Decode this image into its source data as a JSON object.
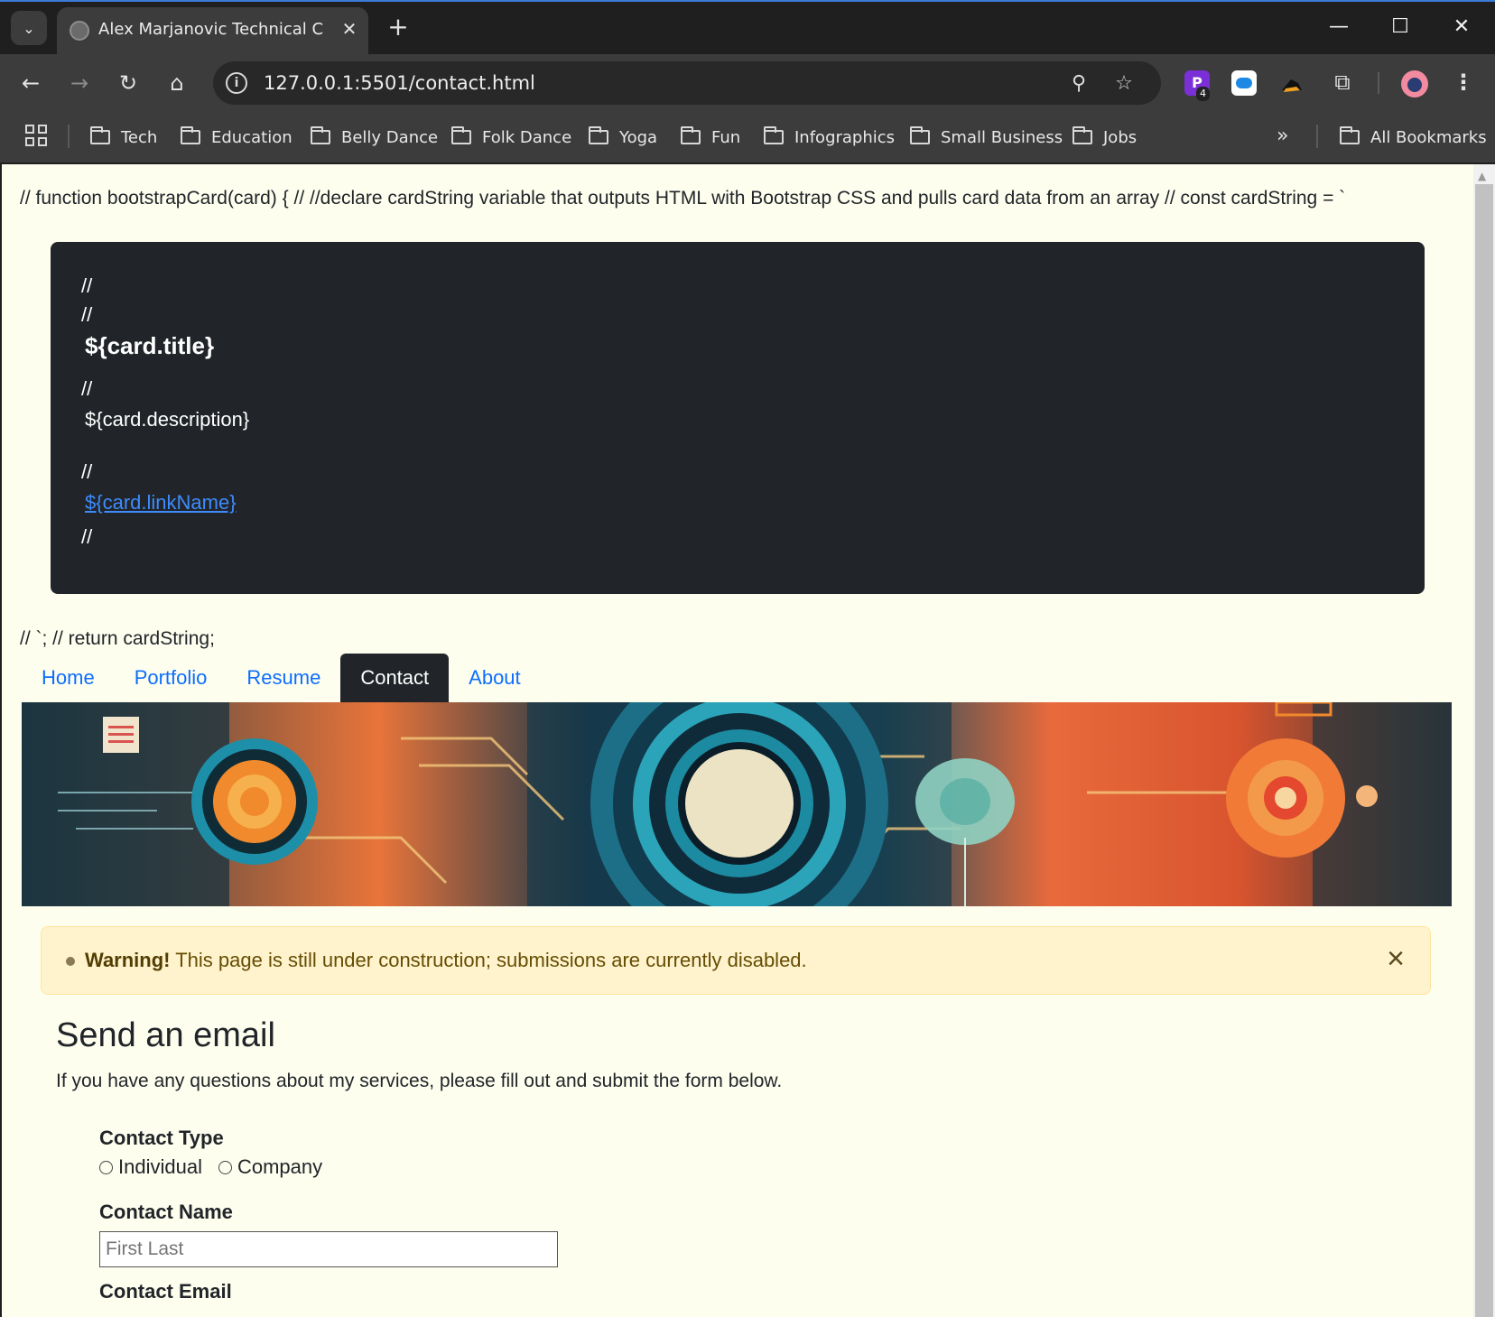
{
  "browser": {
    "tab_title": "Alex Marjanovic Technical Communicator",
    "url": "127.0.0.1:5501/contact.html",
    "bookmarks": [
      "Tech",
      "Education",
      "Belly Dance",
      "Folk Dance",
      "Yoga",
      "Fun",
      "Infographics",
      "Small Business",
      "Jobs"
    ],
    "all_bookmarks_label": "All Bookmarks",
    "extension_badge": "4"
  },
  "page": {
    "code_line_top": "// function bootstrapCard(card) { // //declare cardString variable that outputs HTML with Bootstrap CSS and pulls card data from an array // const cardString = `",
    "card": {
      "comment1": "//",
      "comment2": "//",
      "title": "${card.title}",
      "comment3": "//",
      "description": "${card.description}",
      "comment4": "//",
      "link": "${card.linkName}",
      "comment5": "//"
    },
    "code_line_bottom": "// `; // return cardString;",
    "nav": [
      "Home",
      "Portfolio",
      "Resume",
      "Contact",
      "About"
    ],
    "active_nav": "Contact",
    "alert": {
      "strong": "Warning!",
      "text": "This page is still under construction; submissions are currently disabled."
    },
    "heading": "Send an email",
    "lead": "If you have any questions about my services, please fill out and submit the form below.",
    "form": {
      "contact_type_label": "Contact Type",
      "options": [
        "Individual",
        "Company"
      ],
      "contact_name_label": "Contact Name",
      "contact_name_placeholder": "First Last",
      "contact_email_label": "Contact Email"
    }
  }
}
